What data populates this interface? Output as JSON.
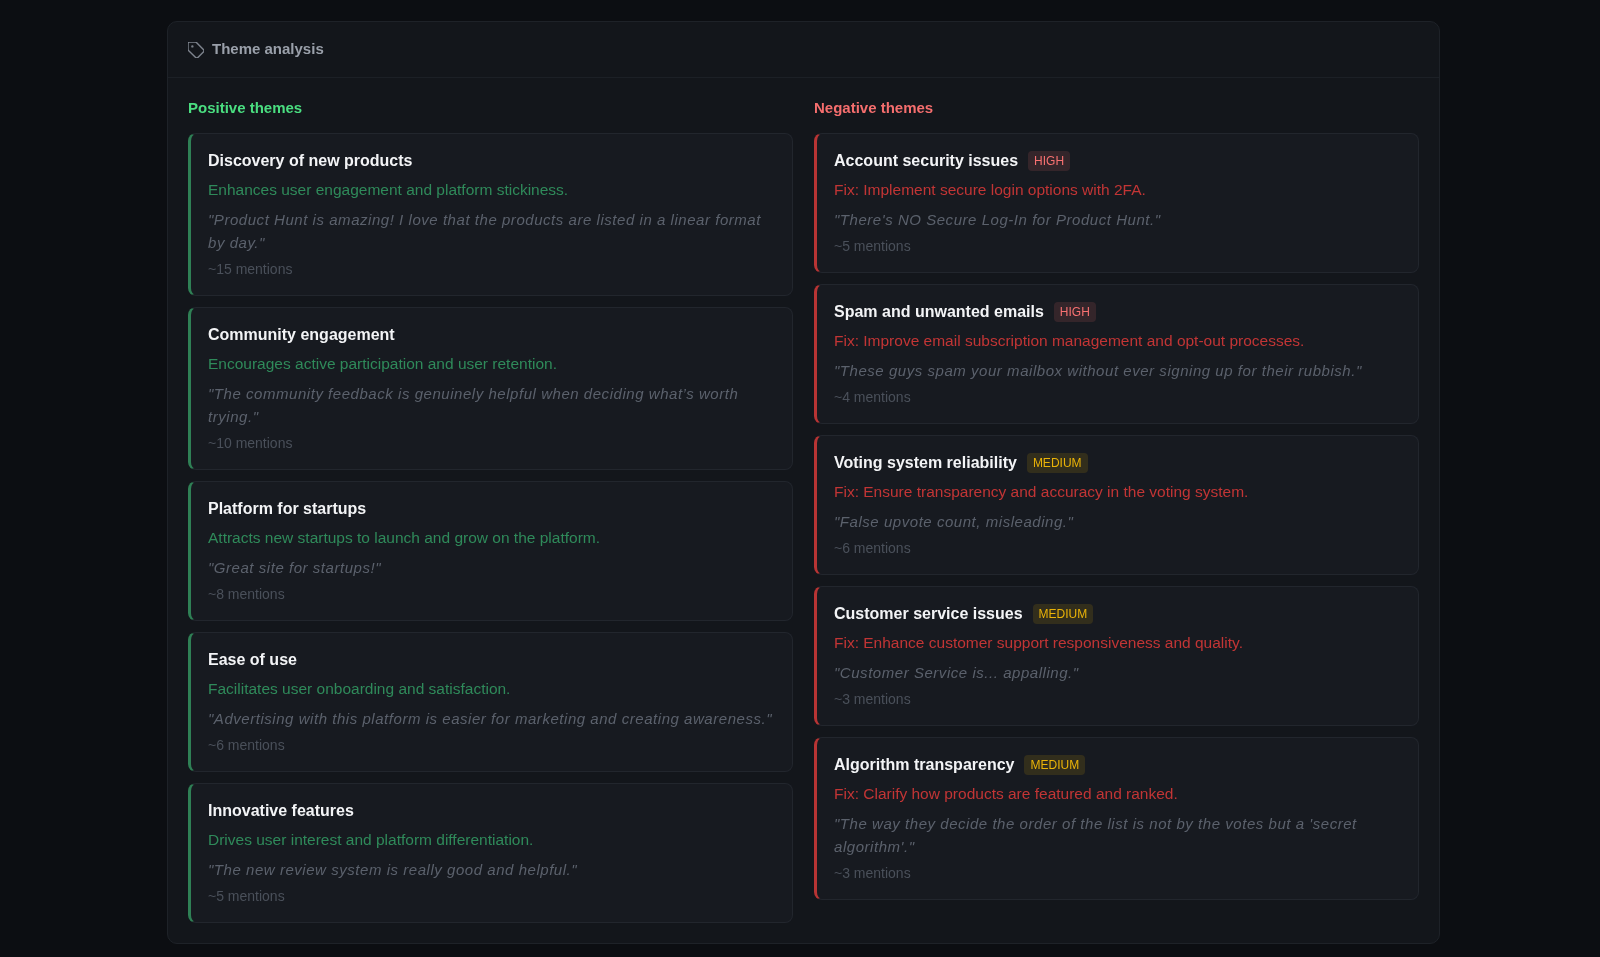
{
  "header": {
    "title": "Theme analysis"
  },
  "positive": {
    "heading": "Positive themes",
    "themes": [
      {
        "title": "Discovery of new products",
        "description": "Enhances user engagement and platform stickiness.",
        "quote": "\"Product Hunt is amazing! I love that the products are listed in a linear format by day.\"",
        "mentions": "~15 mentions"
      },
      {
        "title": "Community engagement",
        "description": "Encourages active participation and user retention.",
        "quote": "\"The community feedback is genuinely helpful when deciding what’s worth trying.\"",
        "mentions": "~10 mentions"
      },
      {
        "title": "Platform for startups",
        "description": "Attracts new startups to launch and grow on the platform.",
        "quote": "\"Great site for startups!\"",
        "mentions": "~8 mentions"
      },
      {
        "title": "Ease of use",
        "description": "Facilitates user onboarding and satisfaction.",
        "quote": "\"Advertising with this platform is easier for marketing and creating awareness.\"",
        "mentions": "~6 mentions"
      },
      {
        "title": "Innovative features",
        "description": "Drives user interest and platform differentiation.",
        "quote": "\"The new review system is really good and helpful.\"",
        "mentions": "~5 mentions"
      }
    ]
  },
  "negative": {
    "heading": "Negative themes",
    "themes": [
      {
        "title": "Account security issues",
        "badge": {
          "label": "HIGH",
          "color": "#f87171"
        },
        "fix": "Fix: Implement secure login options with 2FA.",
        "quote": "\"There's NO Secure Log-In for Product Hunt.\"",
        "mentions": "~5 mentions"
      },
      {
        "title": "Spam and unwanted emails",
        "badge": {
          "label": "HIGH",
          "color": "#f87171"
        },
        "fix": "Fix: Improve email subscription management and opt-out processes.",
        "quote": "\"These guys spam your mailbox without ever signing up for their rubbish.\"",
        "mentions": "~4 mentions"
      },
      {
        "title": "Voting system reliability",
        "badge": {
          "label": "MEDIUM",
          "color": "#eab308"
        },
        "fix": "Fix: Ensure transparency and accuracy in the voting system.",
        "quote": "\"False upvote count, misleading.\"",
        "mentions": "~6 mentions"
      },
      {
        "title": "Customer service issues",
        "badge": {
          "label": "MEDIUM",
          "color": "#eab308"
        },
        "fix": "Fix: Enhance customer support responsiveness and quality.",
        "quote": "\"Customer Service is... appalling.\"",
        "mentions": "~3 mentions"
      },
      {
        "title": "Algorithm transparency",
        "badge": {
          "label": "MEDIUM",
          "color": "#eab308"
        },
        "fix": "Fix: Clarify how products are featured and ranked.",
        "quote": "\"The way they decide the order of the list is not by the votes but a 'secret algorithm'.\"",
        "mentions": "~3 mentions"
      }
    ]
  }
}
